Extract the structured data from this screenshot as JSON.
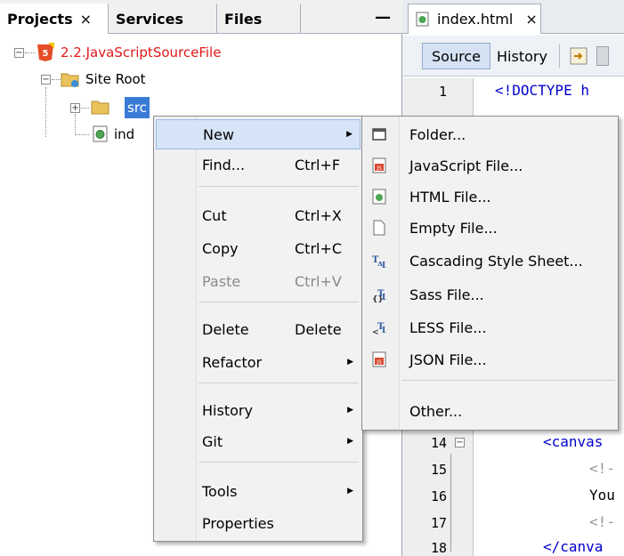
{
  "projects_panel": {
    "tabs": [
      {
        "label": "Projects",
        "close": "×"
      },
      {
        "label": "Services"
      },
      {
        "label": "Files"
      }
    ],
    "minimize": "—",
    "tree": {
      "project": "2.2.JavaScriptSourceFile",
      "site_root": "Site Root",
      "src": "src",
      "index_partial": "ind"
    }
  },
  "editor": {
    "tab_label": "index.html",
    "tab_close": "×",
    "source_label": "Source",
    "history_label": "History",
    "lines": [
      {
        "num": "1",
        "text": "<!DOCTYPE h"
      },
      {
        "num": "14",
        "text": "<canvas"
      },
      {
        "num": "15",
        "text": "<!-"
      },
      {
        "num": "16",
        "text": "You"
      },
      {
        "num": "17",
        "text": "<!-"
      },
      {
        "num": "18",
        "text": "</canva"
      }
    ]
  },
  "context_menu": {
    "items": [
      {
        "label": "New",
        "submenu": true
      },
      {
        "label": "Find...",
        "shortcut": "Ctrl+F"
      },
      {
        "label": "Cut",
        "shortcut": "Ctrl+X"
      },
      {
        "label": "Copy",
        "shortcut": "Ctrl+C"
      },
      {
        "label": "Paste",
        "shortcut": "Ctrl+V",
        "disabled": true
      },
      {
        "label": "Delete",
        "shortcut": "Delete"
      },
      {
        "label": "Refactor",
        "submenu": true
      },
      {
        "label": "History",
        "submenu": true
      },
      {
        "label": "Git",
        "submenu": true
      },
      {
        "label": "Tools",
        "submenu": true
      },
      {
        "label": "Properties"
      }
    ]
  },
  "new_submenu": {
    "items": [
      {
        "label": "Folder...",
        "icon": "folder-icon"
      },
      {
        "label": "JavaScript File...",
        "icon": "js-file-icon"
      },
      {
        "label": "HTML File...",
        "icon": "html-file-icon"
      },
      {
        "label": "Empty File...",
        "icon": "empty-file-icon"
      },
      {
        "label": "Cascading Style Sheet...",
        "icon": "css-file-icon"
      },
      {
        "label": "Sass File...",
        "icon": "sass-file-icon"
      },
      {
        "label": "LESS File...",
        "icon": "less-file-icon"
      },
      {
        "label": "JSON File...",
        "icon": "json-file-icon"
      },
      {
        "label": "Other..."
      }
    ]
  },
  "colors": {
    "project_name": "#e01818",
    "selection": "#3a7bd5",
    "menu_highlight": "#d5e4f6",
    "code_tag": "#0000cc"
  }
}
